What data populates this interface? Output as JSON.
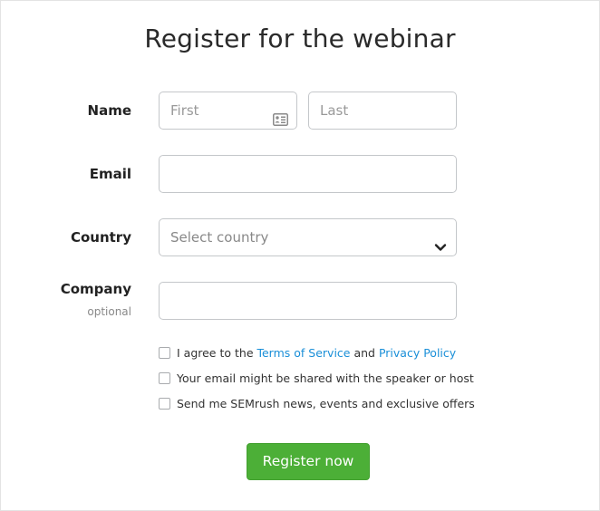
{
  "title": "Register for the webinar",
  "form": {
    "name": {
      "label": "Name",
      "first_placeholder": "First",
      "last_placeholder": "Last",
      "first_icon": "contact-card-icon"
    },
    "email": {
      "label": "Email",
      "value": ""
    },
    "country": {
      "label": "Country",
      "placeholder": "Select country",
      "icon": "chevron-down-icon"
    },
    "company": {
      "label": "Company",
      "sublabel": "optional",
      "value": ""
    },
    "checkboxes": [
      {
        "prefix": "I agree to the ",
        "link1": "Terms of Service",
        "middle": " and ",
        "link2": "Privacy Policy",
        "checked": false
      },
      {
        "text": "Your email might be shared with the speaker or host",
        "checked": false
      },
      {
        "text": "Send me SEMrush news, events and exclusive offers",
        "checked": false
      }
    ],
    "submit_label": "Register now"
  },
  "colors": {
    "accent": "#4caf37",
    "link": "#1a8fd8"
  }
}
